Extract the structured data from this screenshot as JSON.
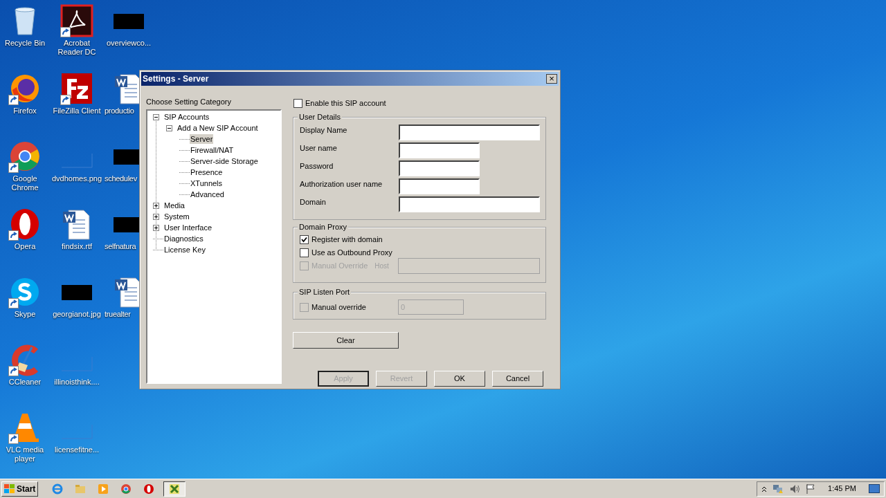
{
  "desktop_columns": [
    [
      {
        "label": "Recycle Bin",
        "kind": "recycle",
        "shortcut": false
      },
      {
        "label": "Firefox",
        "kind": "firefox",
        "shortcut": true
      },
      {
        "label": "Google Chrome",
        "kind": "chrome",
        "shortcut": true
      },
      {
        "label": "Opera",
        "kind": "opera",
        "shortcut": true
      },
      {
        "label": "Skype",
        "kind": "skype",
        "shortcut": true
      },
      {
        "label": "CCleaner",
        "kind": "ccleaner",
        "shortcut": true
      },
      {
        "label": "VLC media player",
        "kind": "vlc",
        "shortcut": true
      }
    ],
    [
      {
        "label": "Acrobat Reader DC",
        "kind": "acrobat",
        "shortcut": true
      },
      {
        "label": "FileZilla Client",
        "kind": "filezilla",
        "shortcut": true
      },
      {
        "label": "dvdhomes.png",
        "kind": "blank",
        "shortcut": false
      },
      {
        "label": "findsix.rtf",
        "kind": "word",
        "shortcut": false
      },
      {
        "label": "georgianot.jpg",
        "kind": "redacted",
        "shortcut": false
      },
      {
        "label": "illinoisthink....",
        "kind": "blank",
        "shortcut": false
      },
      {
        "label": "licensefitne...",
        "kind": "blank",
        "shortcut": false
      }
    ],
    [
      {
        "label": "overviewco...",
        "kind": "redacted",
        "shortcut": false
      },
      {
        "label": "productio",
        "kind": "word",
        "shortcut": false
      },
      {
        "label": "schedulev",
        "kind": "redacted",
        "shortcut": false
      },
      {
        "label": "selfnatura",
        "kind": "redacted",
        "shortcut": false
      },
      {
        "label": "truealter",
        "kind": "word",
        "shortcut": false
      }
    ]
  ],
  "dialog": {
    "title": "Settings - Server",
    "close": "×",
    "category_label": "Choose Setting Category",
    "tree": [
      {
        "label": "SIP Accounts",
        "expanded": true,
        "selected": false,
        "children": [
          {
            "label": "Add a New SIP Account",
            "expanded": true,
            "selected": false,
            "children": [
              {
                "label": "Server",
                "selected": true
              },
              {
                "label": "Firewall/NAT",
                "selected": false
              },
              {
                "label": "Server-side Storage",
                "selected": false
              },
              {
                "label": "Presence",
                "selected": false
              },
              {
                "label": "XTunnels",
                "selected": false
              },
              {
                "label": "Advanced",
                "selected": false
              }
            ]
          }
        ]
      },
      {
        "label": "Media",
        "expanded": false,
        "selected": false
      },
      {
        "label": "System",
        "expanded": false,
        "selected": false
      },
      {
        "label": "User Interface",
        "expanded": false,
        "selected": false
      },
      {
        "label": "Diagnostics",
        "selected": false
      },
      {
        "label": "License Key",
        "selected": false
      }
    ],
    "enable": {
      "label": "Enable this SIP account",
      "checked": false
    },
    "user_details": {
      "title": "User Details",
      "fields": [
        {
          "label": "Display Name"
        },
        {
          "label": "User name"
        },
        {
          "label": "Password"
        },
        {
          "label": "Authorization user name"
        },
        {
          "label": "Domain"
        }
      ]
    },
    "domain_proxy": {
      "title": "Domain Proxy",
      "options": [
        {
          "label": "Register with domain",
          "checked": true,
          "disabled": false
        },
        {
          "label": "Use as Outbound Proxy",
          "checked": false,
          "disabled": false
        },
        {
          "label": "Manual Override",
          "checked": false,
          "disabled": true,
          "host_label": "Host"
        }
      ]
    },
    "sip_listen_port": {
      "title": "SIP Listen Port",
      "label": "Manual override",
      "checked": false,
      "value": "0"
    },
    "clear": "Clear",
    "buttons": [
      {
        "label": "Apply",
        "disabled": true,
        "default": true
      },
      {
        "label": "Revert",
        "disabled": true,
        "default": false
      },
      {
        "label": "OK",
        "disabled": false,
        "default": false
      },
      {
        "label": "Cancel",
        "disabled": false,
        "default": false
      }
    ]
  },
  "taskbar": {
    "start": "Start",
    "apps": [
      {
        "kind": "ie",
        "selected": false
      },
      {
        "kind": "folder",
        "selected": false
      },
      {
        "kind": "media",
        "selected": false
      },
      {
        "kind": "chrome",
        "selected": false
      },
      {
        "kind": "opera",
        "selected": false
      },
      {
        "kind": "x",
        "selected": true
      }
    ],
    "time": "1:45 PM"
  }
}
